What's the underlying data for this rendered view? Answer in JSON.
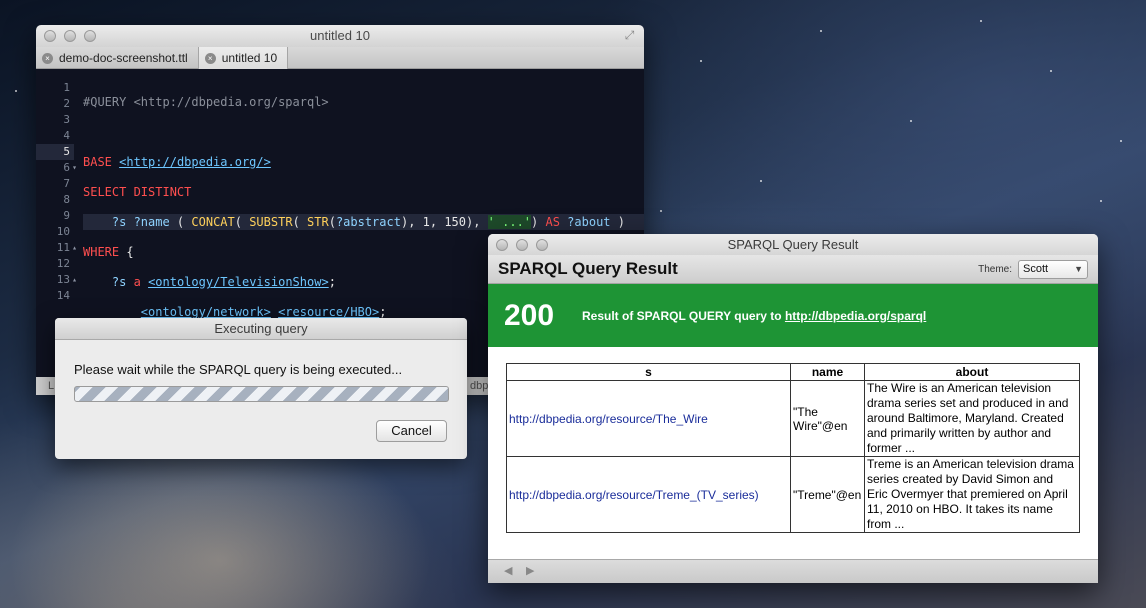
{
  "editor": {
    "title": "untitled 10",
    "tabs": [
      {
        "label": "demo-doc-screenshot.ttl"
      },
      {
        "label": "untitled 10"
      }
    ],
    "line_numbers": [
      "1",
      "2",
      "3",
      "4",
      "5",
      "6",
      "7",
      "8",
      "9",
      "10",
      "11",
      "12",
      "13",
      "14"
    ],
    "status_left": "L",
    "status_right": "dbpe"
  },
  "dialog": {
    "title": "Executing query",
    "message": "Please wait while the SPARQL query is being executed...",
    "cancel_label": "Cancel"
  },
  "result": {
    "window_title": "SPARQL Query Result",
    "heading": "SPARQL Query Result",
    "theme_label": "Theme:",
    "theme_value": "Scott",
    "status_code": "200",
    "status_text": "Result of SPARQL QUERY query to",
    "endpoint": "http://dbpedia.org/sparql",
    "columns": [
      "s",
      "name",
      "about"
    ],
    "rows": [
      {
        "s": "http://dbpedia.org/resource/The_Wire",
        "name": "\"The Wire\"@en",
        "about": "The Wire is an American television drama series set and produced in and around Baltimore, Maryland. Created and primarily written by author and former ..."
      },
      {
        "s": "http://dbpedia.org/resource/Treme_(TV_series)",
        "name": "\"Treme\"@en",
        "about": "Treme is an American television drama series created by David Simon and Eric Overmyer that premiered on April 11, 2010 on HBO. It takes its name from ..."
      }
    ],
    "nav_back": "◀",
    "nav_forward": "▶"
  },
  "colors": {
    "banner_green": "#1e9435",
    "link_blue": "#1a2d9a"
  }
}
